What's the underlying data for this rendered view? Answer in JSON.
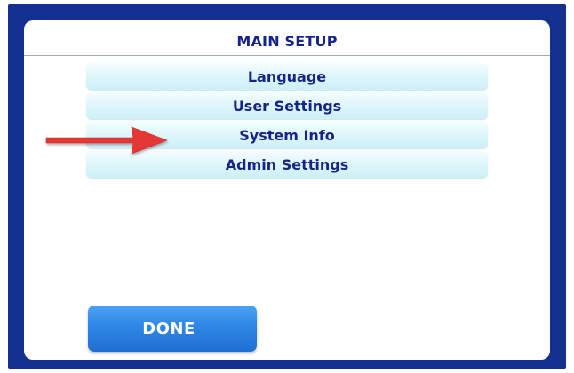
{
  "screen": {
    "title": "MAIN SETUP"
  },
  "menu": {
    "items": [
      {
        "label": "Language"
      },
      {
        "label": "User Settings"
      },
      {
        "label": "System Info"
      },
      {
        "label": "Admin Settings"
      }
    ]
  },
  "annotation": {
    "arrow_color": "#e53935",
    "points_to": "System Info"
  },
  "done_button": {
    "label": "DONE"
  },
  "colors": {
    "frame": "#14308e",
    "text": "#16238a",
    "button": "#2e86e6",
    "menu_item": "#dcf6fb"
  }
}
